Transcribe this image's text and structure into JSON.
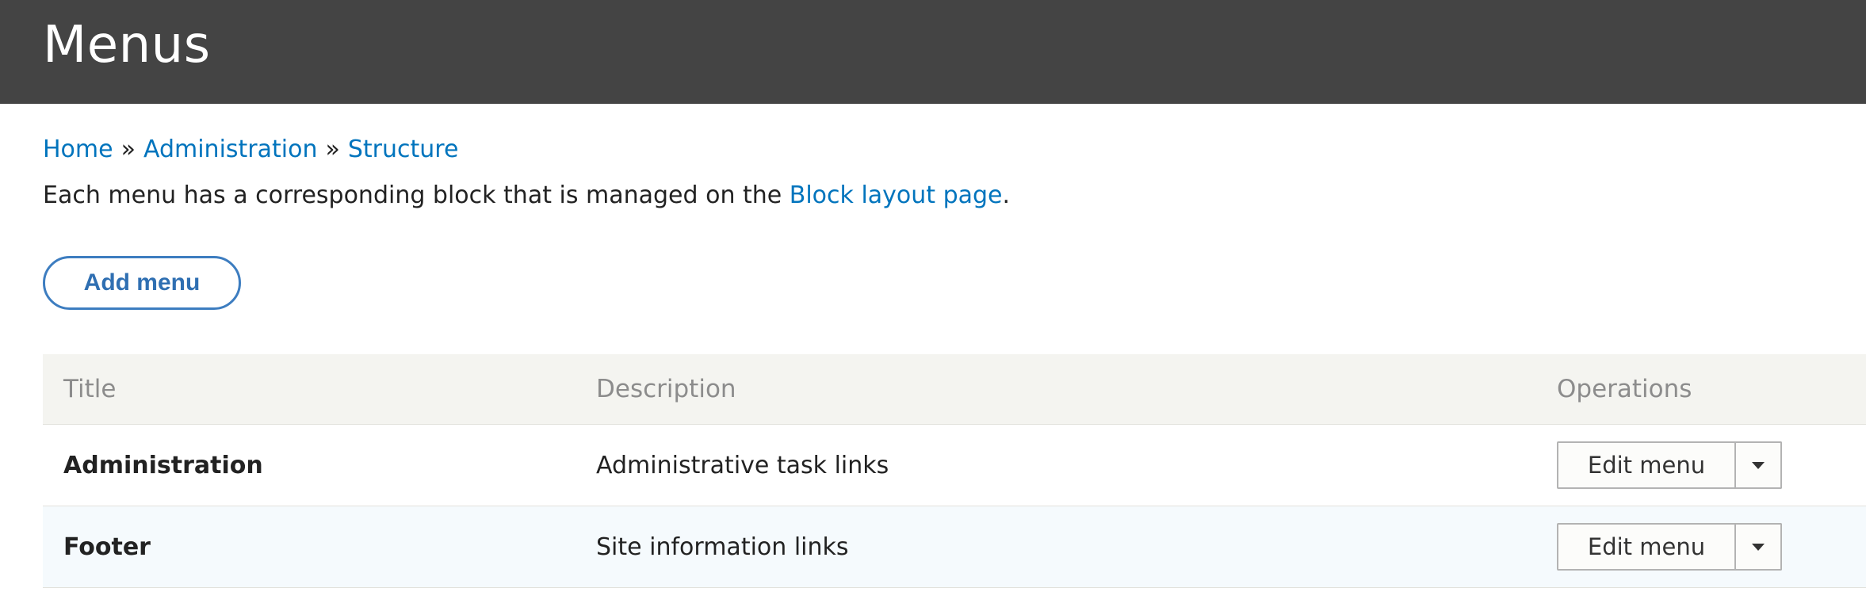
{
  "header": {
    "title": "Menus"
  },
  "breadcrumb": {
    "items": [
      "Home",
      "Administration",
      "Structure"
    ],
    "separator": "»"
  },
  "help": {
    "text_before": "Each menu has a corresponding block that is managed on the ",
    "link_text": "Block layout page",
    "text_after": "."
  },
  "actions": {
    "add_menu": "Add menu"
  },
  "table": {
    "headers": {
      "title": "Title",
      "description": "Description",
      "operations": "Operations"
    },
    "rows": [
      {
        "title": "Administration",
        "description": "Administrative task links",
        "operation": "Edit menu"
      },
      {
        "title": "Footer",
        "description": "Site information links",
        "operation": "Edit menu"
      }
    ]
  },
  "icons": {
    "dropdown": "chevron-down-icon"
  },
  "colors": {
    "header_bg": "#444444",
    "link": "#0074bd",
    "button_border": "#3d7dc0",
    "table_header_bg": "#f4f4f0"
  }
}
